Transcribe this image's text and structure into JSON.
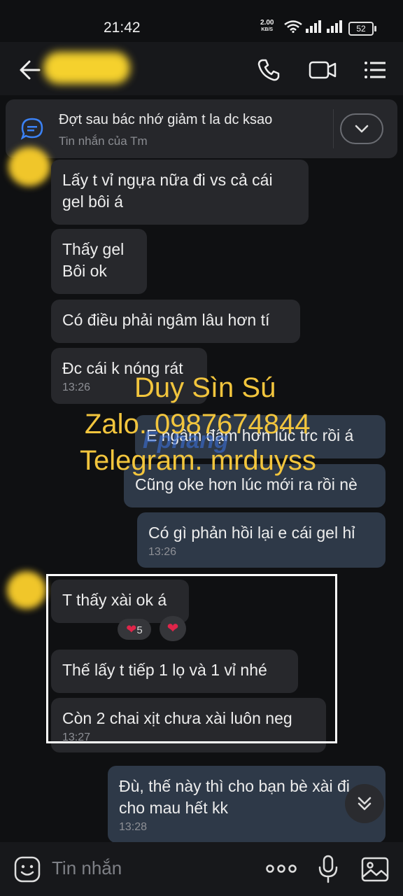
{
  "status_bar": {
    "time": "21:42",
    "net_speed": "2.00",
    "net_unit": "KB/S",
    "battery": "52"
  },
  "pinned": {
    "text": "Đợt sau bác nhớ giảm t la dc ksao",
    "subtext": "Tin nhắn của Tm"
  },
  "messages": {
    "m1": "Lấy t vỉ ngựa nữa đi vs cả cái gel bôi á",
    "m2": "Thấy gel Bôi ok",
    "m3": "Có điều phải ngâm lâu hơn tí",
    "m4": "Đc cái k nóng rát",
    "m4_time": "13:26",
    "o1": "E ngâm đậm hơn lúc trc rồi á",
    "o2": "Cũng oke hơn lúc mới ra rồi nè",
    "o3": "Có gì phản hồi lại e cái gel hỉ",
    "o3_time": "13:26",
    "m5": "T thấy xài ok á",
    "m5_react_count": "5",
    "m6": "Thế lấy t tiếp 1 lọ và 1 vỉ nhé",
    "m7": "Còn 2 chai xịt chưa xài luôn neg",
    "m7_time": "13:27",
    "o4": "Đù, thế này thì cho bạn bè xài đi cho mau hết kk",
    "o4_time": "13:28"
  },
  "watermark": {
    "line1": "Duy Sìn Sú",
    "line2": "Zalo. 0987674844",
    "line3": "Telegram. mrduyss",
    "logo": "Fphang"
  },
  "composer": {
    "placeholder": "Tin nhắn"
  },
  "colors": {
    "accent": "#3b82f6",
    "watermark": "#f2c53d",
    "heart": "#e0254a"
  }
}
